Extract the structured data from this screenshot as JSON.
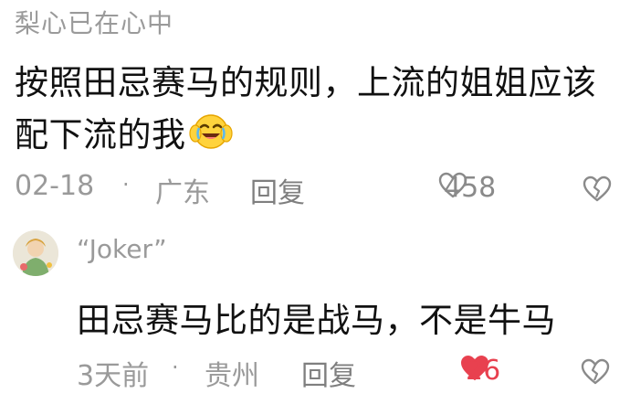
{
  "comment": {
    "username": "梨心已在心中",
    "text": "按照田忌赛马的规则，上流的姐姐应该配下流的我",
    "emoji": "laughing-crying-emoji",
    "date": "02-18",
    "separator": "·",
    "location": "广东",
    "reply_label": "回复",
    "like_count": "458",
    "liked": false
  },
  "reply": {
    "username": "“Joker”",
    "text": "田忌赛马比的是战马，不是牛马",
    "time": "3天前",
    "separator": "·",
    "location": "贵州",
    "reply_label": "回复",
    "like_count": "26",
    "liked": true
  },
  "colors": {
    "meta_gray": "#9a9a9a",
    "like_red": "#e8414f",
    "text_black": "#111111"
  }
}
